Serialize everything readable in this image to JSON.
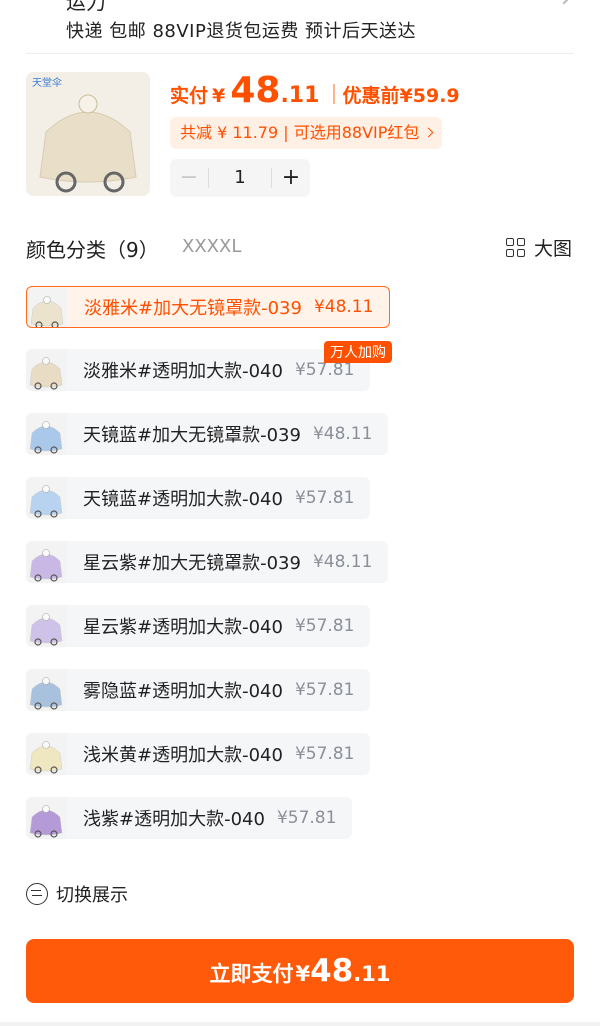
{
  "top": {
    "cut_text": "运力",
    "delivery_text": "快递 包邮 88VIP退货包运费 预计后天送达"
  },
  "product": {
    "thumb_text": "天堂伞"
  },
  "pricing": {
    "pay_label": "实付",
    "currency": "¥",
    "pay_int": "48",
    "pay_dec": ".11",
    "original_label": "优惠前",
    "original_price": "¥59.9",
    "saving_text": "共减 ¥ 11.79 | 可选用88VIP红包"
  },
  "quantity": {
    "minus": "−",
    "value": "1",
    "plus": "+"
  },
  "section": {
    "title": "颜色分类（9）",
    "size": "XXXXL",
    "big_view_label": "大图"
  },
  "hot_badge": "万人加购",
  "variants": [
    {
      "name": "淡雅米#加大无镜罩款-039",
      "price": "¥48.11",
      "color": "#ece3cf"
    },
    {
      "name": "淡雅米#透明加大款-040",
      "price": "¥57.81",
      "color": "#e8dcc4"
    },
    {
      "name": "天镜蓝#加大无镜罩款-039",
      "price": "¥48.11",
      "color": "#a9c8ea"
    },
    {
      "name": "天镜蓝#透明加大款-040",
      "price": "¥57.81",
      "color": "#b7d3ef"
    },
    {
      "name": "星云紫#加大无镜罩款-039",
      "price": "¥48.11",
      "color": "#c9b8e6"
    },
    {
      "name": "星云紫#透明加大款-040",
      "price": "¥57.81",
      "color": "#cfc2e8"
    },
    {
      "name": "雾隐蓝#透明加大款-040",
      "price": "¥57.81",
      "color": "#a8c2de"
    },
    {
      "name": "浅米黄#透明加大款-040",
      "price": "¥57.81",
      "color": "#efe7bf"
    },
    {
      "name": "浅紫#透明加大款-040",
      "price": "¥57.81",
      "color": "#b49ad6"
    }
  ],
  "toggle_label": "切换展示",
  "pay_button": {
    "label": "立即支付",
    "currency": "¥",
    "int": "48",
    "dec": ".11"
  },
  "colors": {
    "accent": "#ff5000",
    "button": "#ff5a0a"
  }
}
